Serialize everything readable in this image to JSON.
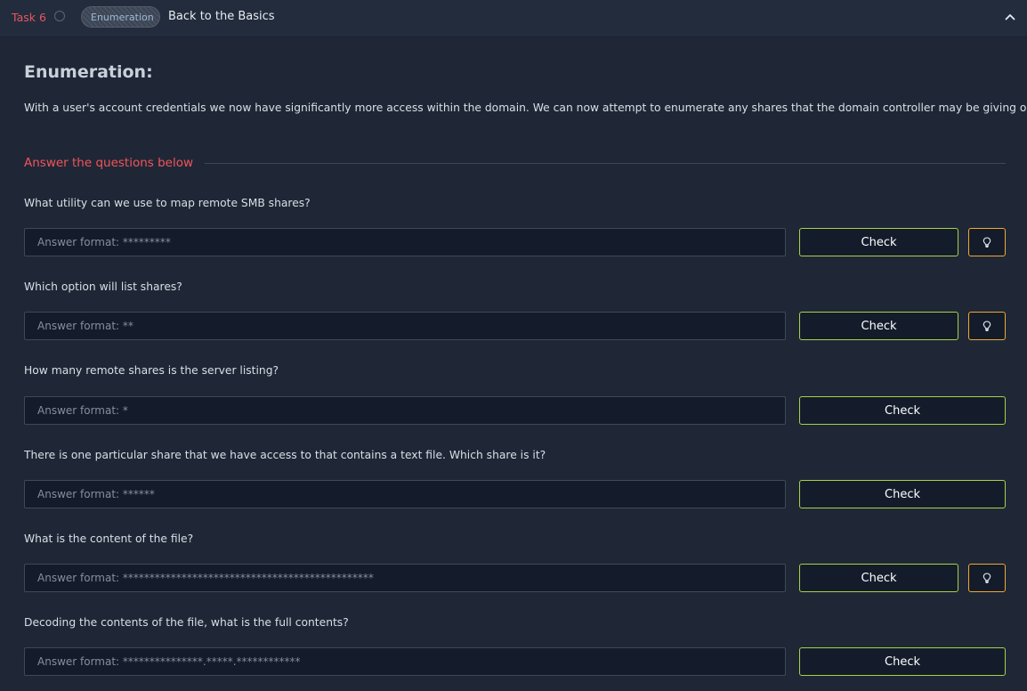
{
  "header": {
    "task_number": "Task 6",
    "tag": "Enumeration",
    "title": "Back to the Basics"
  },
  "content": {
    "heading": "Enumeration:",
    "intro": "With a user's account credentials we now have significantly more access within the domain. We can now attempt to enumerate any shares that the domain controller may be giving out.",
    "answer_heading": "Answer the questions below"
  },
  "questions": [
    {
      "question": "What utility can we use to map remote SMB shares?",
      "placeholder": "Answer format: *********",
      "check_label": "Check",
      "has_hint": true
    },
    {
      "question": "Which option will list shares?",
      "placeholder": "Answer format: **",
      "check_label": "Check",
      "has_hint": true
    },
    {
      "question": "How many remote shares is the server listing?",
      "placeholder": "Answer format: *",
      "check_label": "Check",
      "has_hint": false
    },
    {
      "question": "There is one particular share that we have access to that contains a text file. Which share is it?",
      "placeholder": "Answer format: ******",
      "check_label": "Check",
      "has_hint": false
    },
    {
      "question": "What is the content of the file?",
      "placeholder": "Answer format: ***********************************************",
      "check_label": "Check",
      "has_hint": true
    },
    {
      "question": "Decoding the contents of the file, what is the full contents?",
      "placeholder": "Answer format: ***************.*****.************",
      "check_label": "Check",
      "has_hint": false
    }
  ],
  "colors": {
    "accent_red": "#f2545b",
    "check_border": "#a6d147",
    "hint_border": "#f0a830",
    "background": "#1f2736"
  },
  "icons": {
    "status": "circle-outline-icon",
    "collapse": "chevron-up-icon",
    "hint": "lightbulb-icon"
  }
}
